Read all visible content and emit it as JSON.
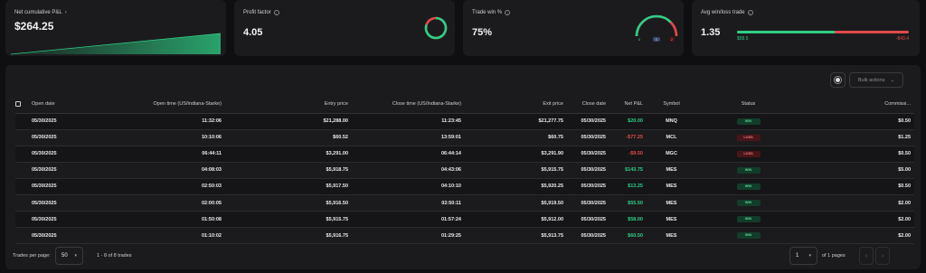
{
  "cards": {
    "net_pnl": {
      "title": "Net cumulative P&L",
      "value": "$264.25",
      "chart_color": "#2ecf86"
    },
    "profit_factor": {
      "title": "Profit factor",
      "value": "4.05",
      "ratio": 0.8
    },
    "trade_win": {
      "title": "Trade win %",
      "value": "75%",
      "wins": "6",
      "breakeven": "0",
      "losses": "2",
      "win_fraction": 0.75
    },
    "avg_win_loss": {
      "title": "Avg win/loss trade",
      "value": "1.35",
      "avg_win": "$58.5",
      "avg_loss": "-$43.4",
      "win_share": 0.57
    }
  },
  "toolbar": {
    "bulk_actions": "Bulk actions"
  },
  "table": {
    "headers": [
      "Open date",
      "Open time (US/Indiana-Starke)",
      "Entry price",
      "Close time (US/Indiana-Starke)",
      "Exit price",
      "Close date",
      "Net P&L",
      "Symbol",
      "Status",
      "Commissi..."
    ],
    "rows": [
      [
        "05/30/2025",
        "11:32:06",
        "$21,288.00",
        "11:23:45",
        "$21,277.75",
        "05/30/2025",
        "$20.00",
        "MNQ",
        "WIN",
        "$0.50"
      ],
      [
        "05/30/2025",
        "10:10:06",
        "$60.52",
        "13:59:01",
        "$60.75",
        "05/30/2025",
        "-$77.25",
        "MCL",
        "LOSS",
        "$1.25"
      ],
      [
        "05/30/2025",
        "06:44:11",
        "$3,291.00",
        "06:44:14",
        "$3,291.90",
        "05/30/2025",
        "-$9.50",
        "MGC",
        "LOSS",
        "$0.50"
      ],
      [
        "05/30/2025",
        "04:08:03",
        "$5,918.75",
        "04:43:06",
        "$5,915.75",
        "05/30/2025",
        "$143.75",
        "MES",
        "WIN",
        "$5.00"
      ],
      [
        "05/30/2025",
        "02:50:03",
        "$5,917.50",
        "04:10:10",
        "$5,920.25",
        "05/30/2025",
        "$13.25",
        "MES",
        "WIN",
        "$0.50"
      ],
      [
        "05/30/2025",
        "02:00:05",
        "$5,916.50",
        "02:50:11",
        "$5,919.50",
        "05/30/2025",
        "$55.50",
        "MES",
        "WIN",
        "$2.00"
      ],
      [
        "05/30/2025",
        "01:50:08",
        "$5,915.75",
        "01:57:24",
        "$5,912.00",
        "05/30/2025",
        "$58.00",
        "MES",
        "WIN",
        "$2.00"
      ],
      [
        "05/30/2025",
        "01:10:02",
        "$5,916.75",
        "01:29:25",
        "$5,913.75",
        "05/30/2025",
        "$60.50",
        "MES",
        "WIN",
        "$2.00"
      ]
    ]
  },
  "footer": {
    "trades_per_page_label": "Trades per page:",
    "trades_per_page_value": "50",
    "range_text": "1 - 8 of 8 trades",
    "page_value": "1",
    "of_pages": "of 1 pages"
  },
  "icons": {
    "info": "info-icon",
    "chevron": "chevron-down-icon",
    "settings": "settings-icon",
    "prev": "chevron-left-icon",
    "next": "chevron-right-icon"
  },
  "colors": {
    "win": "#2ecf86",
    "loss": "#e24a4a",
    "panel": "#1b1b1d",
    "background": "#0f0f11"
  }
}
